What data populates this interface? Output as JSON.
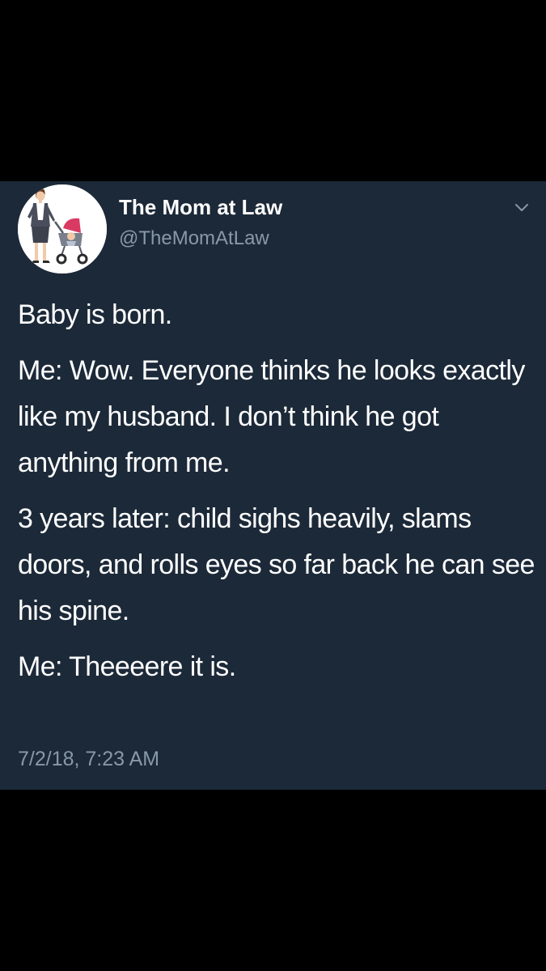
{
  "tweet": {
    "author": {
      "display_name": "The Mom at Law",
      "handle": "@TheMomAtLaw",
      "avatar": "avatar-mom-with-stroller-illustration"
    },
    "menu_icon": "chevron-down-icon",
    "paragraphs": [
      "Baby is born.",
      "Me: Wow. Everyone thinks he looks exactly like my husband. I don’t think he got anything from me.",
      "3 years later: child sighs heavily, slams doors, and rolls eyes so far back he can see his spine.",
      "Me: Theeeere it is."
    ],
    "timestamp": "7/2/18, 7:23 AM"
  },
  "colors": {
    "page_background": "#000000",
    "card_background": "#1c2938",
    "primary_text": "#ffffff",
    "secondary_text": "#8899a6"
  }
}
